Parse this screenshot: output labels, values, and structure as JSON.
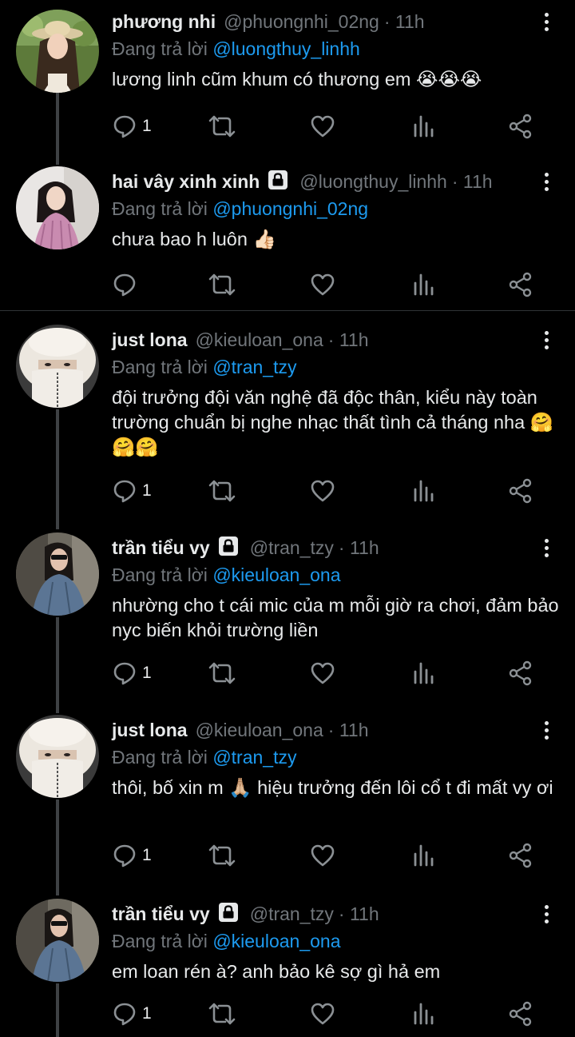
{
  "reply_prefix": "Đang trả lời",
  "tweets": [
    {
      "name": "phương nhi",
      "handle": "@phuongnhi_02ng",
      "time": "· 11h",
      "reply_to": "@luongthuy_linhh",
      "text": "lương linh cũm khum có thương em 😭😭😭",
      "reply_count": "1",
      "locked": false
    },
    {
      "name": "hai vây xinh xinh",
      "handle": "@luongthuy_linhh",
      "time": "· 11h",
      "reply_to": "@phuongnhi_02ng",
      "text": "chưa bao h luôn 👍🏻",
      "reply_count": "",
      "locked": true
    },
    {
      "name": "just lona",
      "handle": "@kieuloan_ona",
      "time": "· 11h",
      "reply_to": "@tran_tzy",
      "text": "đội trưởng đội văn nghệ đã độc thân, kiểu này toàn trường chuẩn bị nghe nhạc thất tình cả tháng nha 🤗🤗🤗",
      "reply_count": "1",
      "locked": false
    },
    {
      "name": "trần tiểu vy",
      "handle": "@tran_tzy",
      "time": "· 11h",
      "reply_to": "@kieuloan_ona",
      "text": "nhường cho t cái mic của m mỗi giờ ra chơi, đảm bảo nyc biến khỏi trường liền",
      "reply_count": "1",
      "locked": true
    },
    {
      "name": "just lona",
      "handle": "@kieuloan_ona",
      "time": "· 11h",
      "reply_to": "@tran_tzy",
      "text": "thôi, bố xin m 🙏🏼 hiệu trưởng đến lôi cổ t đi mất vy ơi",
      "reply_count": "1",
      "locked": false
    },
    {
      "name": "trần tiểu vy",
      "handle": "@tran_tzy",
      "time": "· 11h",
      "reply_to": "@kieuloan_ona",
      "text": "em loan rén à? anh bảo kê sợ gì hả em",
      "reply_count": "1",
      "locked": true
    }
  ],
  "icons": {
    "reply": "reply-icon",
    "retweet": "retweet-icon",
    "like": "heart-icon",
    "views": "views-icon",
    "share": "share-icon",
    "more": "more-vertical-icon",
    "lock": "lock-icon"
  },
  "colors": {
    "background": "#000000",
    "text": "#e7e9ea",
    "muted": "#71767b",
    "link": "#1d9bf0"
  }
}
